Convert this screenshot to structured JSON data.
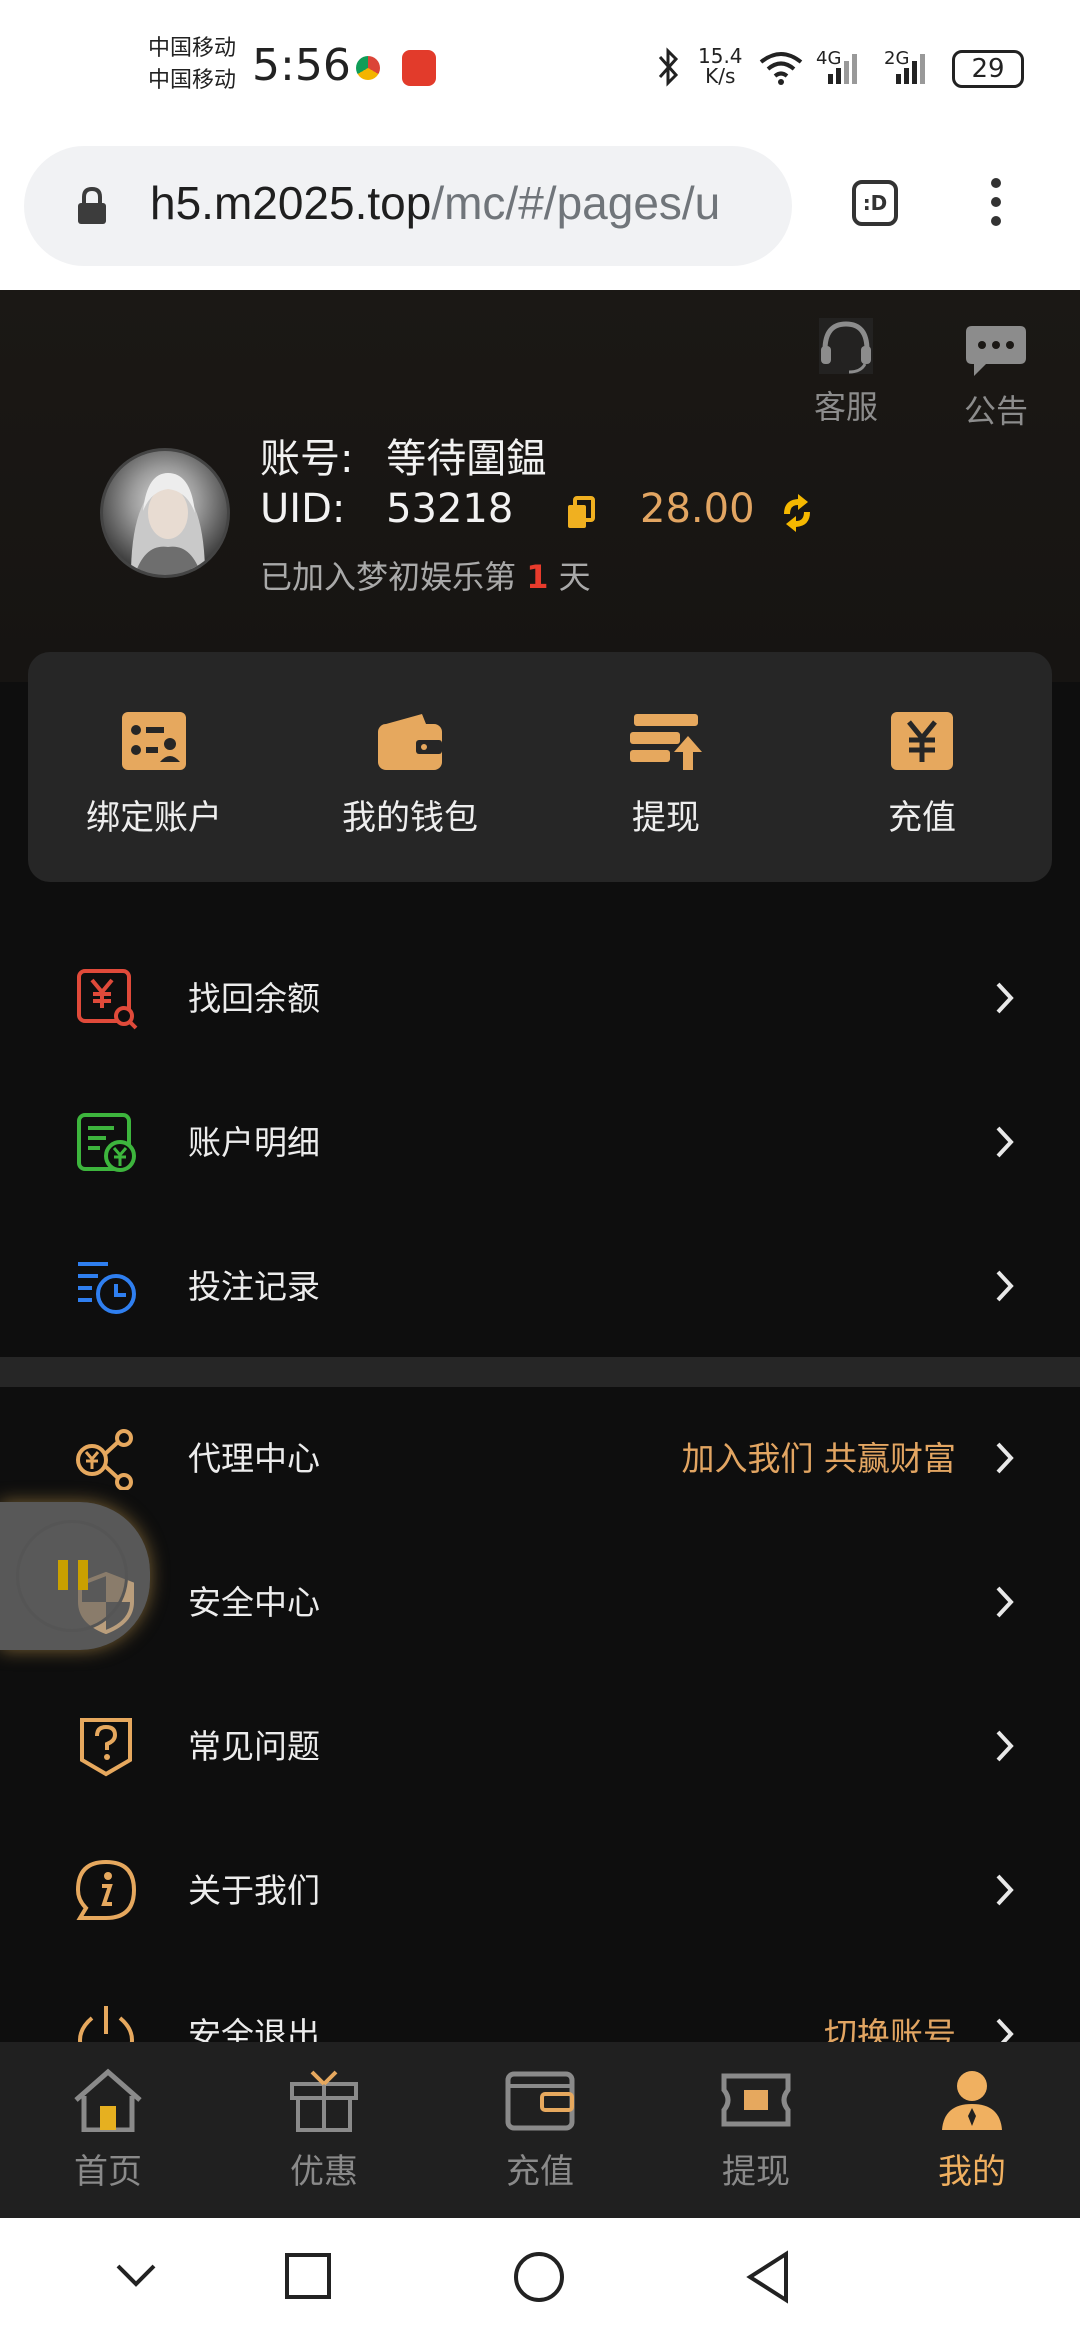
{
  "status_bar": {
    "carrier1": "中国移动",
    "carrier2": "中国移动",
    "time": "5:56",
    "net_speed_top": "15.4",
    "net_speed_bottom": "K/s",
    "signal1": "4G",
    "signal2": "2G",
    "battery": "29"
  },
  "browser": {
    "url_host": "h5.m2025.top",
    "url_path": "/mc/#/pages/u",
    "tab_switch_label": ":D"
  },
  "header": {
    "service_label": "客服",
    "notice_label": "公告",
    "account_label": "账号:",
    "account_value": "等待圍鎾",
    "uid_label": "UID:",
    "uid_value": "53218",
    "balance": "28.00",
    "joined_prefix": "已加入梦初娱乐第",
    "joined_days": "1",
    "joined_suffix": "天"
  },
  "actions": [
    {
      "label": "绑定账户",
      "icon": "id-card-icon"
    },
    {
      "label": "我的钱包",
      "icon": "wallet-icon"
    },
    {
      "label": "提现",
      "icon": "withdraw-icon"
    },
    {
      "label": "充值",
      "icon": "yen-icon"
    }
  ],
  "menu_group1": [
    {
      "label": "找回余额",
      "icon": "yen-search-icon",
      "color": "#e04a3a"
    },
    {
      "label": "账户明细",
      "icon": "statement-icon",
      "color": "#3db53d"
    },
    {
      "label": "投注记录",
      "icon": "history-icon",
      "color": "#2f7ff0"
    }
  ],
  "menu_group2": [
    {
      "label": "代理中心",
      "extra": "加入我们 共赢财富",
      "icon": "share-yen-icon"
    },
    {
      "label": "安全中心",
      "extra": "",
      "icon": "shield-icon"
    },
    {
      "label": "常见问题",
      "extra": "",
      "icon": "question-icon"
    },
    {
      "label": "关于我们",
      "extra": "",
      "icon": "info-icon"
    },
    {
      "label": "安全退出",
      "extra": "切换账号",
      "icon": "power-icon"
    }
  ],
  "bottom_nav": [
    {
      "label": "首页",
      "icon": "home-icon"
    },
    {
      "label": "优惠",
      "icon": "gift-icon"
    },
    {
      "label": "充值",
      "icon": "wallet-icon"
    },
    {
      "label": "提现",
      "icon": "withdraw-card-icon"
    },
    {
      "label": "我的",
      "icon": "user-icon",
      "active": true
    }
  ],
  "colors": {
    "accent": "#e2a562",
    "background": "#0e0e0e",
    "card": "#262626",
    "highlight_red": "#e83b2c"
  }
}
